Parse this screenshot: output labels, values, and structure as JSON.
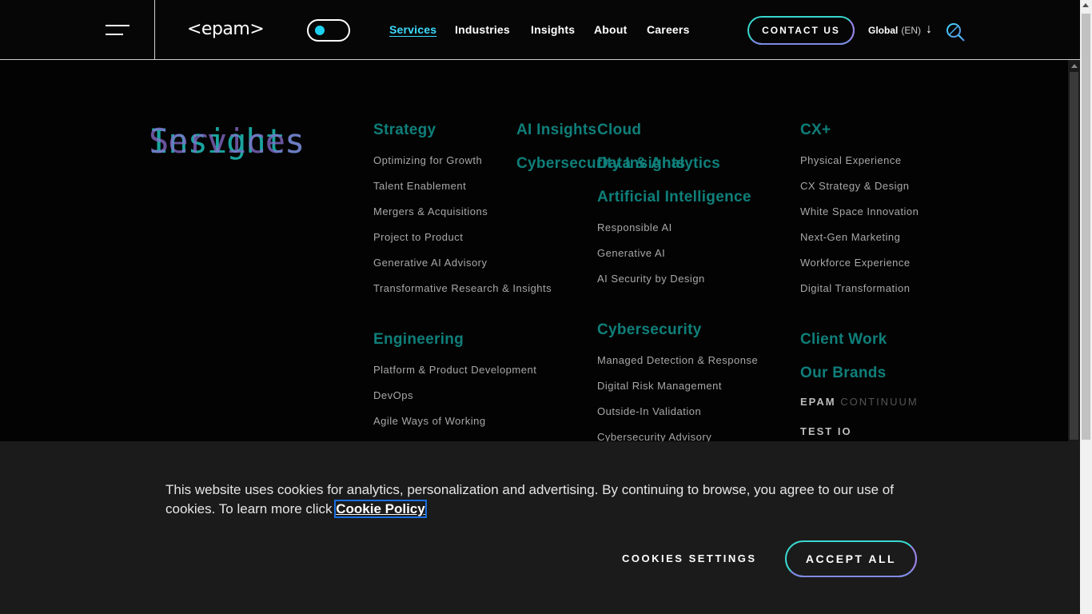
{
  "header": {
    "logo": "<epam>",
    "nav": [
      "Services",
      "Industries",
      "Insights",
      "About",
      "Careers"
    ],
    "contact_label": "CONTACT US",
    "region": "Global",
    "language": "(EN)",
    "icons": {
      "menu": "hamburger-menu-icon",
      "arrow": "arrow-down-icon",
      "search": "search-icon"
    }
  },
  "menu": {
    "title_front": "Insights",
    "title_back": "Services",
    "strategy": {
      "label": "Strategy",
      "items": [
        "Optimizing for Growth",
        "Talent Enablement",
        "Mergers & Acquisitions",
        "Project to Product",
        "Generative AI Advisory",
        "Transformative Research & Insights"
      ]
    },
    "ai_insights": "AI Insights",
    "cybersecurity_insights": "Cybersecurity Insights",
    "cloud": "Cloud",
    "data_analytics": "Data & Analytics",
    "artificial_intelligence": {
      "label": "Artificial Intelligence",
      "items": [
        "Responsible AI",
        "Generative AI",
        "AI Security by Design"
      ]
    },
    "engineering": {
      "label": "Engineering",
      "items": [
        "Platform & Product Development",
        "DevOps",
        "Agile Ways of Working"
      ]
    },
    "cybersecurity": {
      "label": "Cybersecurity",
      "items": [
        "Managed Detection & Response",
        "Digital Risk Management",
        "Outside-In Validation",
        "Cybersecurity Advisory"
      ]
    },
    "cx": {
      "label": "CX+",
      "items": [
        "Physical Experience",
        "CX Strategy & Design",
        "White Space Innovation",
        "Next-Gen Marketing",
        "Workforce Experience",
        "Digital Transformation"
      ]
    },
    "client_work": "Client Work",
    "our_brands": "Our Brands",
    "brand_continuum_a": "EPAM",
    "brand_continuum_b": "CONTINUUM",
    "brand_testio": "TEST IO"
  },
  "cookie": {
    "text": "This website uses cookies for analytics, personalization and advertising. By continuing to browse, you agree to our use of cookies. To learn more click ",
    "link": "Cookie Policy",
    "settings": "COOKIES SETTINGS",
    "accept": "ACCEPT ALL"
  },
  "colors": {
    "accent": "#3ddcff",
    "teal": "#0f7f7a",
    "gradient_end": "#9e7ce8"
  }
}
